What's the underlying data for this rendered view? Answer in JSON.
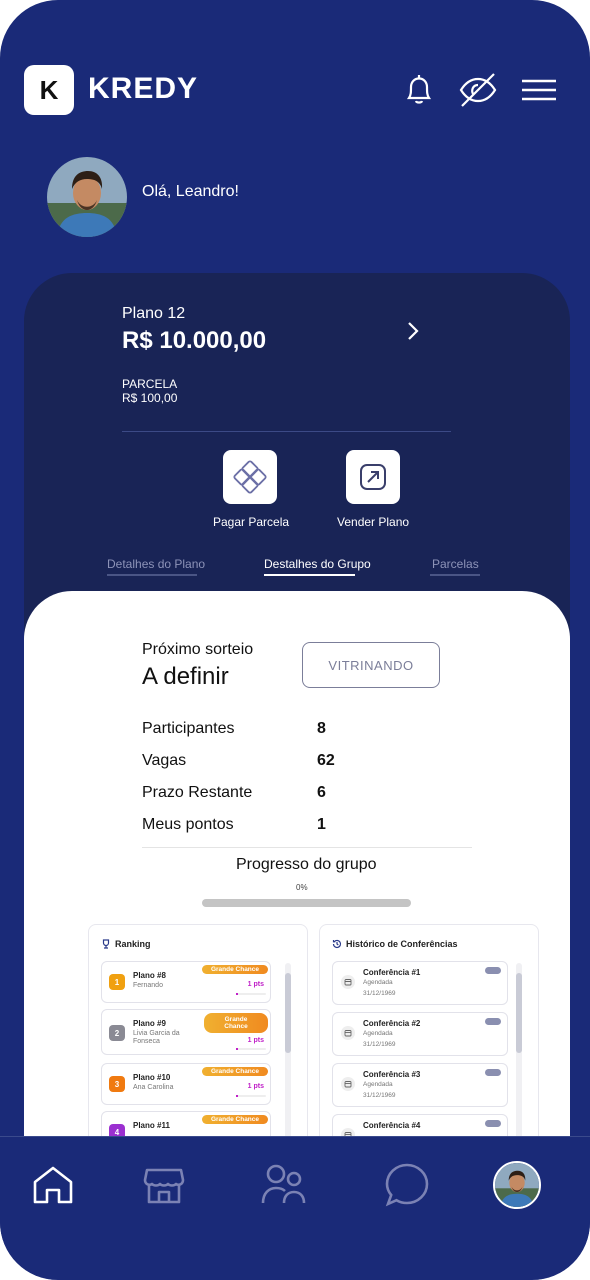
{
  "header": {
    "logo_letter": "K",
    "brand": "KREDY",
    "icons": [
      "bell-icon",
      "eye-off-icon",
      "menu-icon"
    ]
  },
  "user": {
    "greeting": "Olá, Leandro!"
  },
  "plan": {
    "name": "Plano 12",
    "value": "R$ 10.000,00",
    "parcela_label": "PARCELA",
    "parcela_value": "R$ 100,00",
    "actions": [
      {
        "label": "Pagar Parcela",
        "icon": "pay-icon"
      },
      {
        "label": "Vender Plano",
        "icon": "sell-icon"
      }
    ],
    "tabs": [
      "Detalhes do Plano",
      "Destalhes do Grupo",
      "Parcelas"
    ],
    "active_tab": 1
  },
  "group": {
    "next_draw_label": "Próximo sorteio",
    "next_draw_value": "A definir",
    "status_button": "VITRINANDO",
    "stats": [
      {
        "label": "Participantes",
        "value": "8"
      },
      {
        "label": "Vagas",
        "value": "62"
      },
      {
        "label": "Prazo Restante",
        "value": "6"
      },
      {
        "label": "Meus pontos",
        "value": "1"
      }
    ],
    "progress_title": "Progresso do grupo",
    "progress_pct_text": "0%",
    "progress_value": 0
  },
  "ranking": {
    "title": "Ranking",
    "items": [
      {
        "num": "1",
        "plan": "Plano #8",
        "name": "Fernando",
        "badge": "Grande Chance",
        "pts": "1 pts",
        "color": "#f0a010"
      },
      {
        "num": "2",
        "plan": "Plano #9",
        "name": "Livia Garcia da Fonseca",
        "badge": "Grande Chance",
        "pts": "1 pts",
        "color": "#8a8a94"
      },
      {
        "num": "3",
        "plan": "Plano #10",
        "name": "Ana Carolina",
        "badge": "Grande Chance",
        "pts": "1 pts",
        "color": "#f07a10"
      },
      {
        "num": "4",
        "plan": "Plano #11",
        "name": "",
        "badge": "Grande Chance",
        "pts": "",
        "color": "#9b30d0"
      }
    ]
  },
  "history": {
    "title": "Histórico de Conferências",
    "items": [
      {
        "title": "Conferência #1",
        "status": "Agendada",
        "date": "31/12/1969"
      },
      {
        "title": "Conferência #2",
        "status": "Agendada",
        "date": "31/12/1969"
      },
      {
        "title": "Conferência #3",
        "status": "Agendada",
        "date": "31/12/1969"
      },
      {
        "title": "Conferência #4",
        "status": "",
        "date": ""
      }
    ]
  },
  "nav": [
    "home-icon",
    "store-icon",
    "people-icon",
    "chat-icon",
    "profile-avatar"
  ],
  "colors": {
    "background": "#1a2a78",
    "card": "#192456",
    "accent_orange": "#f08a20",
    "points": "#c020c8"
  }
}
